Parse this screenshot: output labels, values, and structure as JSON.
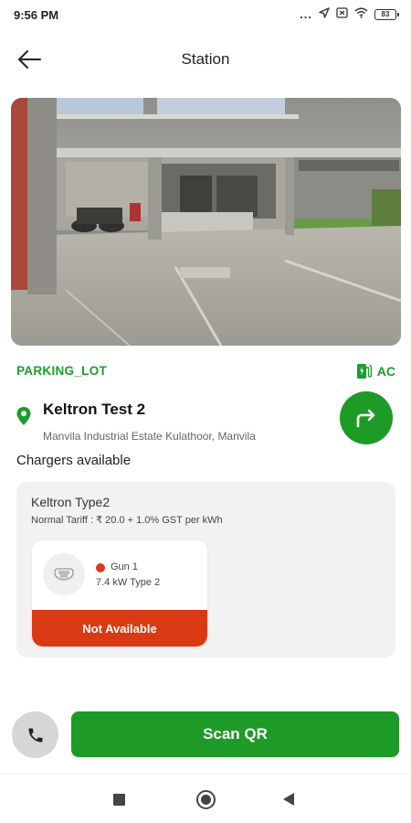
{
  "status_bar": {
    "time": "9:56 PM",
    "dots": "...",
    "battery": "83"
  },
  "header": {
    "title": "Station"
  },
  "station": {
    "type_label": "PARKING_LOT",
    "current_type": "AC",
    "name": "Keltron Test 2",
    "address": "Manvila Industrial Estate Kulathoor, Manvila"
  },
  "chargers": {
    "heading": "Chargers available",
    "items": [
      {
        "name": "Keltron Type2",
        "tariff": "Normal Tariff : ₹ 20.0 + 1.0% GST per kWh",
        "guns": [
          {
            "name": "Gun 1",
            "spec": "7.4 kW Type 2",
            "status": "Not Available"
          }
        ]
      }
    ]
  },
  "actions": {
    "scan_label": "Scan QR"
  },
  "colors": {
    "brand_green": "#1e9a26",
    "label_green": "#1a9d2b",
    "unavailable_red": "#d93a13"
  }
}
